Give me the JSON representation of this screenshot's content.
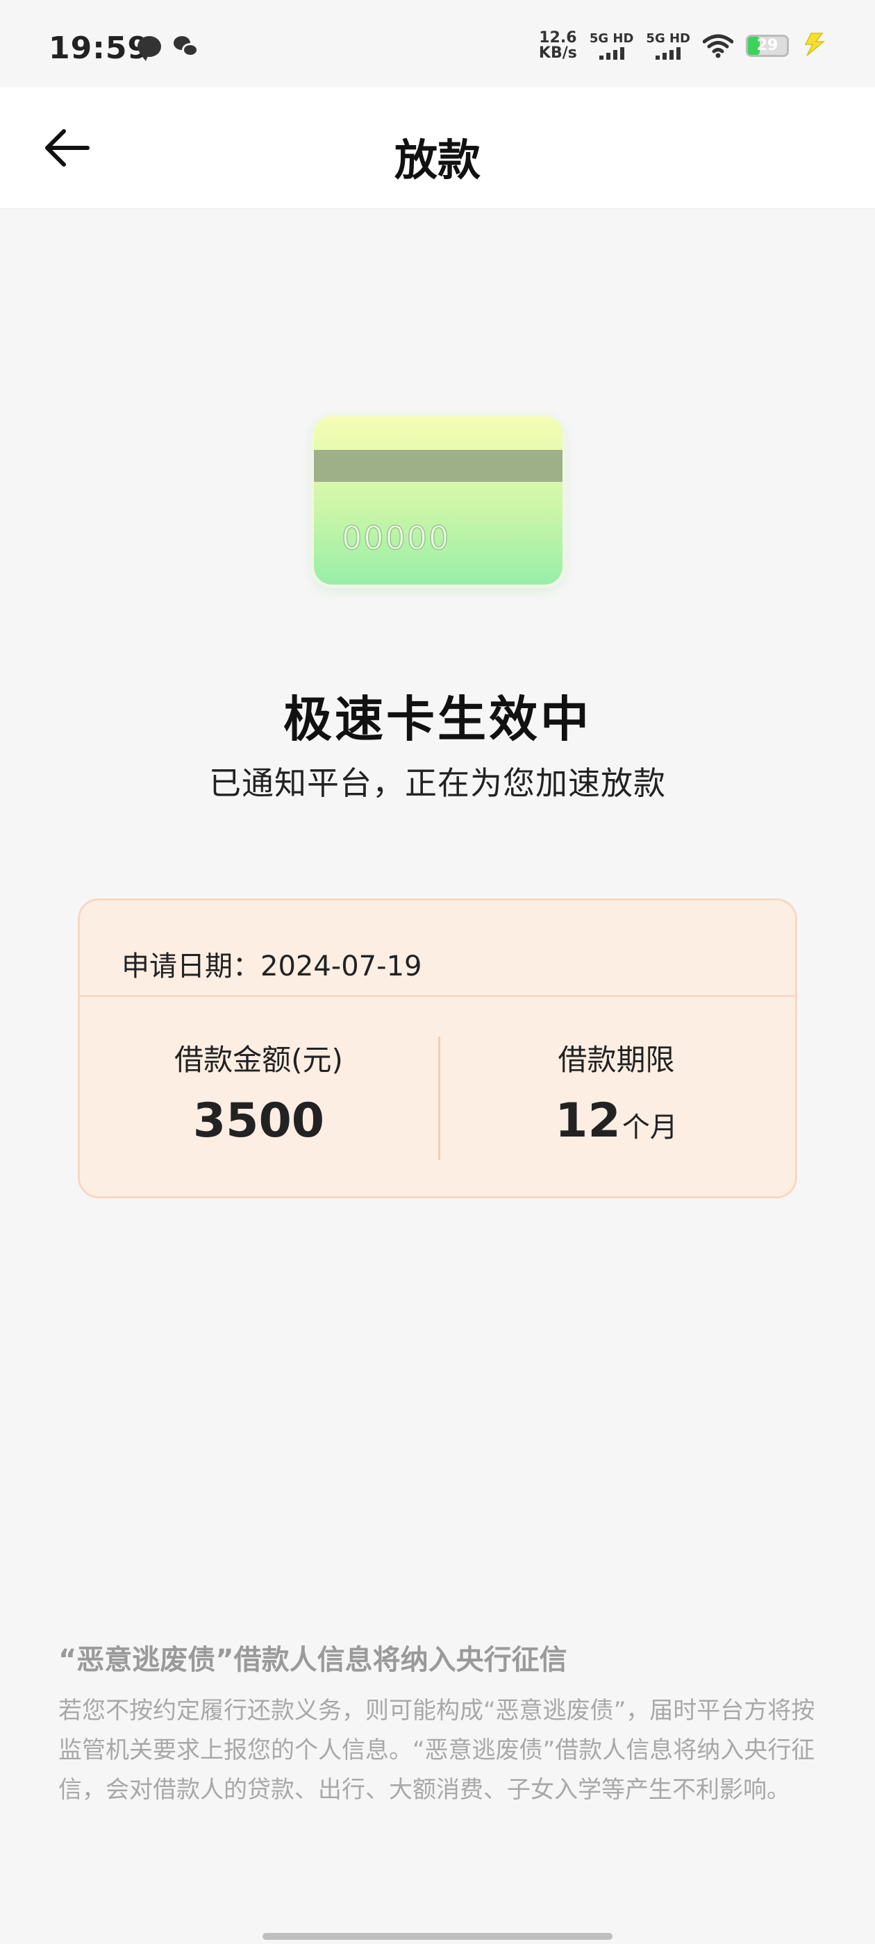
{
  "status_bar": {
    "time": "19:59",
    "net_speed_value": "12.6",
    "net_speed_unit": "KB/s",
    "sim1_label": "5G HD",
    "sim2_label": "5G HD",
    "battery_level": "29",
    "icons": [
      "chat-bubble-icon",
      "wechat-icon",
      "wifi-icon",
      "battery-icon",
      "charging-bolt-icon"
    ]
  },
  "nav": {
    "title": "放款",
    "back_icon": "arrow-left-icon"
  },
  "card": {
    "number": "00000",
    "colors": {
      "top": "#f6fdb4",
      "bottom": "#98eea8",
      "stripe": "#9db088"
    }
  },
  "status_message": {
    "headline": "极速卡生效中",
    "subline": "已通知平台，正在为您加速放款"
  },
  "loan": {
    "apply_date_label": "申请日期：",
    "apply_date": "2024-07-19",
    "amount_label": "借款金额(元)",
    "amount": "3500",
    "term_label": "借款期限",
    "term_value": "12",
    "term_unit": "个月",
    "colors": {
      "panel_bg": "#fdeee4",
      "panel_border": "#f9d7c2"
    }
  },
  "notice": {
    "title": "“恶意逃废债”借款人信息将纳入央行征信",
    "body": "若您不按约定履行还款义务，则可能构成“恶意逃废债”，届时平台方将按监管机关要求上报您的个人信息。“恶意逃废债”借款人信息将纳入央行征信，会对借款人的贷款、出行、大额消费、子女入学等产生不利影响。"
  }
}
